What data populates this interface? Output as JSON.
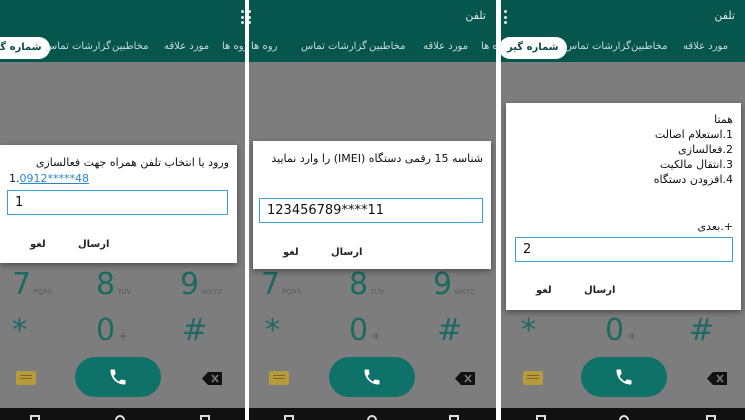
{
  "app": {
    "title": "تلفن",
    "tabs": [
      "شماره گیر",
      "گزارشات تماس",
      "مخاطبین",
      "مورد علاقه",
      "گروه ها"
    ]
  },
  "dialpad": {
    "rows": [
      {
        "digit": "7",
        "letters": "PQRS"
      },
      {
        "digit": "8",
        "letters": "TUV"
      },
      {
        "digit": "9",
        "letters": "WXYZ"
      }
    ],
    "star": "*",
    "zero": "0",
    "plus": "+",
    "hash": "#"
  },
  "dialog1": {
    "message": "ورود یا انتخاب تلفن همراه جهت فعالسازی",
    "phone_prefix": "1.",
    "phone_link": "0912*****48",
    "input_value": "1",
    "send_label": "ارسال",
    "cancel_label": "لغو"
  },
  "dialog2": {
    "message": "شناسه 15 رقمی دستگاه (IMEI) را وارد نمایید",
    "input_value": "123456789****11",
    "send_label": "ارسال",
    "cancel_label": "لغو"
  },
  "dialog3": {
    "menu": [
      "همتا",
      "1.استعلام اصالت",
      "2.فعالسازی",
      "3.انتقال مالکیت",
      "4.افزودن دستگاه"
    ],
    "next": "+.بعدی",
    "input_value": "2",
    "send_label": "ارسال",
    "cancel_label": "لغو"
  },
  "colors": {
    "appbar": "#06564e",
    "accent": "#0e7268",
    "dim_overlay": "#7d7d7d",
    "input_border": "#3e9ee0",
    "link": "#2a85d1"
  }
}
